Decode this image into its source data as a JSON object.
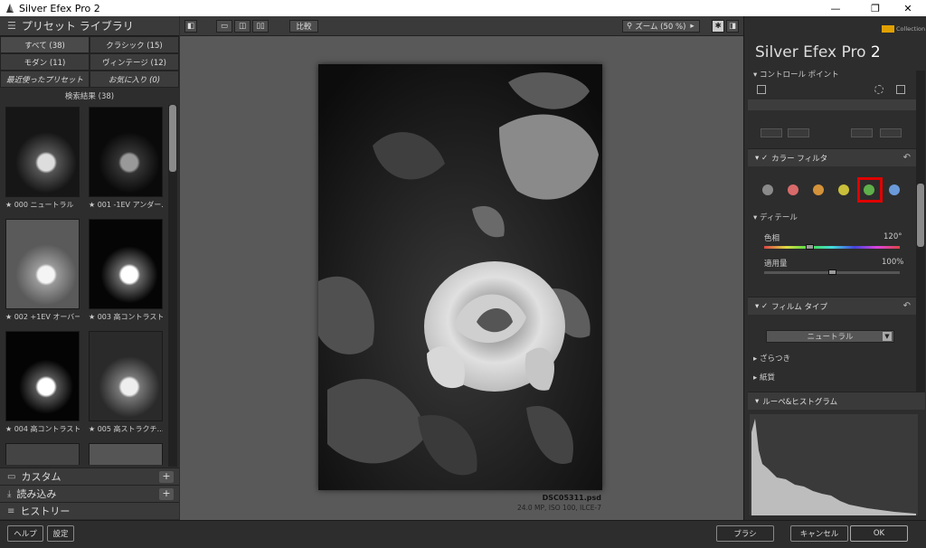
{
  "window": {
    "title": "Silver Efex Pro 2",
    "min": "—",
    "restore": "❐",
    "close": "✕"
  },
  "left": {
    "header": "プリセット ライブラリ",
    "filters": [
      "すべて (38)",
      "クラシック (15)",
      "モダン (11)",
      "ヴィンテージ (12)",
      "最近使ったプリセット",
      "お気に入り (0)"
    ],
    "results": "検索結果 (38)",
    "thumbs": [
      "★ 000 ニュートラル",
      "★ 001 -1EV アンダー…",
      "★ 002 +1EV オーバー…",
      "★ 003 高コントラスト…",
      "★ 004 高コントラスト…",
      "★ 005 高ストラクチ…"
    ],
    "sections": [
      {
        "label": "カスタム",
        "plus": "+"
      },
      {
        "label": "読み込み",
        "plus": "+"
      },
      {
        "label": "ヒストリー",
        "plus": ""
      }
    ]
  },
  "toolbar": {
    "compare": "比較",
    "zoom": "ズーム (50 %)"
  },
  "image": {
    "filename": "DSC05311.psd",
    "meta": "24.0 MP, ISO 100, ILCE-7"
  },
  "right": {
    "brand": "Silver Efex Pro",
    "brand_version": "2",
    "collection": "Collection",
    "control_points": "コントロール ポイント",
    "color_filter": "カラー フィルタ",
    "color_dots": [
      "#8a8a8a",
      "#d96a6a",
      "#d4923a",
      "#c9bf3a",
      "#5fb04a",
      "#6a9ad9"
    ],
    "selected_color_index": 4,
    "detail": "ディテール",
    "hue_label": "色相",
    "hue_value": "120°",
    "strength_label": "適用量",
    "strength_value": "100%",
    "hue_fraction": 0.33,
    "strength_fraction": 0.5,
    "film_type": "フィルム タイプ",
    "film_select": "ニュートラル",
    "grain": "ざらつき",
    "paper": "紙質",
    "histogram": "ルーペ&ヒストグラム"
  },
  "bottom": {
    "help": "ヘルプ",
    "settings": "設定",
    "brush": "ブラシ",
    "cancel": "キャンセル",
    "ok": "OK"
  }
}
